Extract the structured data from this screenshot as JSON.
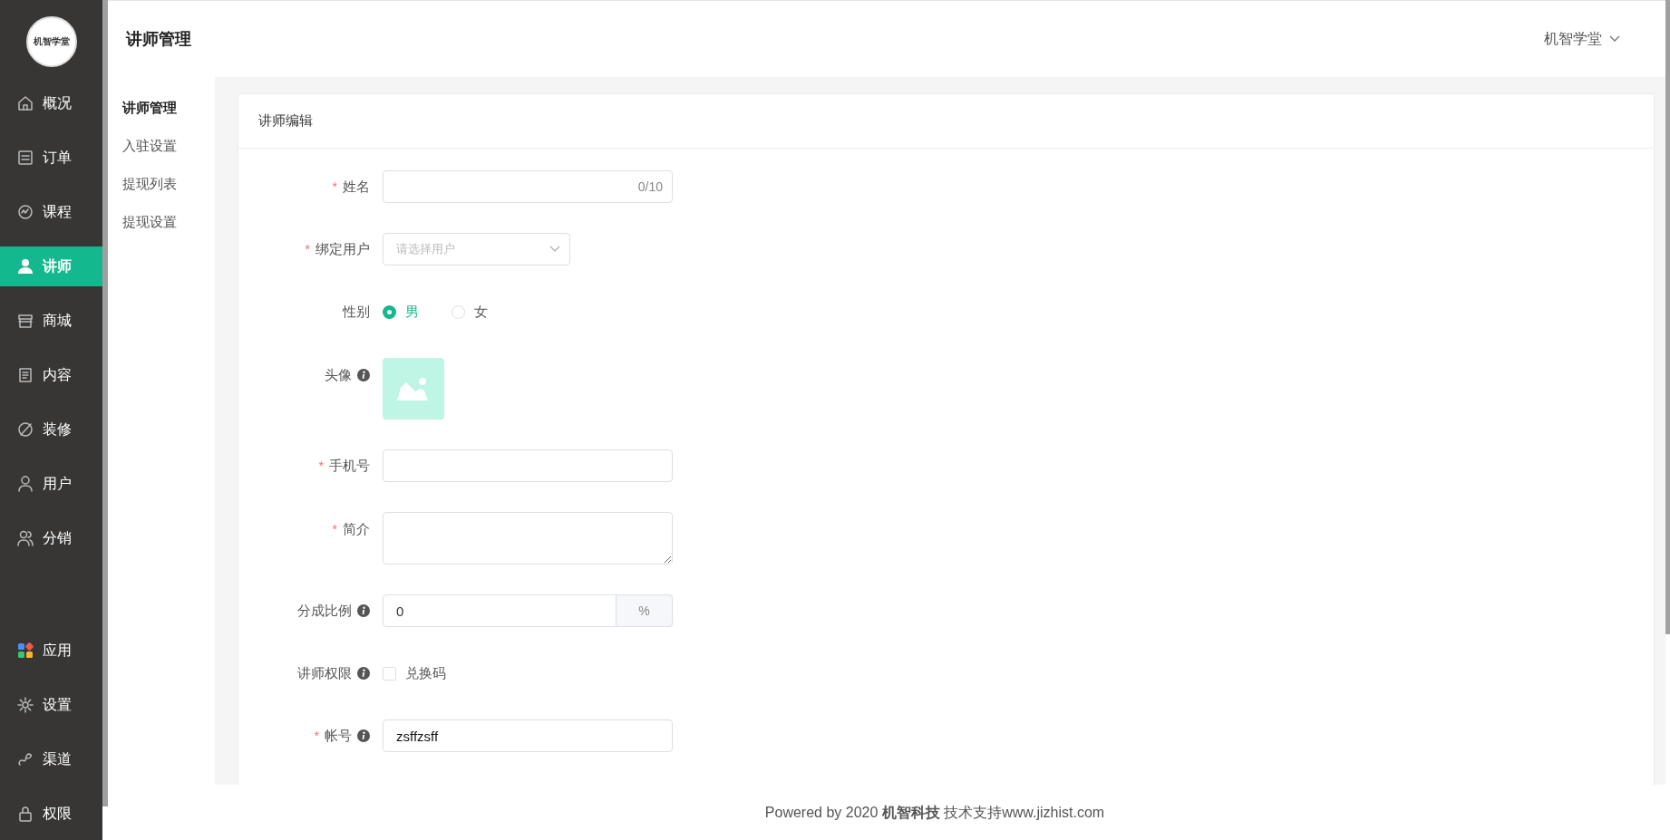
{
  "logo": {
    "text": "机智学堂"
  },
  "sidebar": {
    "items": [
      {
        "label": "概况",
        "selected": false
      },
      {
        "label": "订单",
        "selected": false
      },
      {
        "label": "课程",
        "selected": false
      },
      {
        "label": "讲师",
        "selected": true
      },
      {
        "label": "商城",
        "selected": false
      },
      {
        "label": "内容",
        "selected": false
      },
      {
        "label": "装修",
        "selected": false
      },
      {
        "label": "用户",
        "selected": false
      },
      {
        "label": "分销",
        "selected": false
      },
      {
        "label": "应用",
        "selected": false
      },
      {
        "label": "设置",
        "selected": false
      },
      {
        "label": "渠道",
        "selected": false
      },
      {
        "label": "权限",
        "selected": false
      }
    ]
  },
  "header": {
    "title": "讲师管理",
    "account": "机智学堂"
  },
  "subnav": {
    "items": [
      {
        "label": "讲师管理",
        "selected": true
      },
      {
        "label": "入驻设置",
        "selected": false
      },
      {
        "label": "提现列表",
        "selected": false
      },
      {
        "label": "提现设置",
        "selected": false
      }
    ]
  },
  "card": {
    "title": "讲师编辑"
  },
  "form": {
    "fields": [
      {
        "kind": "text",
        "label": "姓名",
        "required_mark": "*",
        "counter": "0/10"
      },
      {
        "kind": "select",
        "label": "绑定用户",
        "required_mark": "*",
        "placeholder": "请选择用户"
      },
      {
        "kind": "radio",
        "label": "性别",
        "options": [
          {
            "label": "男",
            "selected": true
          },
          {
            "label": "女",
            "selected": false
          }
        ]
      },
      {
        "kind": "image",
        "label": "头像",
        "info": true
      },
      {
        "kind": "text",
        "label": "手机号",
        "required_mark": "*"
      },
      {
        "kind": "textarea",
        "label": "简介",
        "required_mark": "*"
      },
      {
        "kind": "addon",
        "label": "分成比例",
        "info": true,
        "value": "0",
        "suffix": "%"
      },
      {
        "kind": "checkbox",
        "label": "讲师权限",
        "info": true,
        "options": [
          {
            "label": "兑换码",
            "checked": false
          }
        ]
      },
      {
        "kind": "text",
        "label": "帐号",
        "required_mark": "*",
        "info": true,
        "value": "zsffzsff"
      }
    ]
  },
  "footer": {
    "text": "Powered by 2020 **机智科技** 技术支持www.jizhist.com"
  }
}
